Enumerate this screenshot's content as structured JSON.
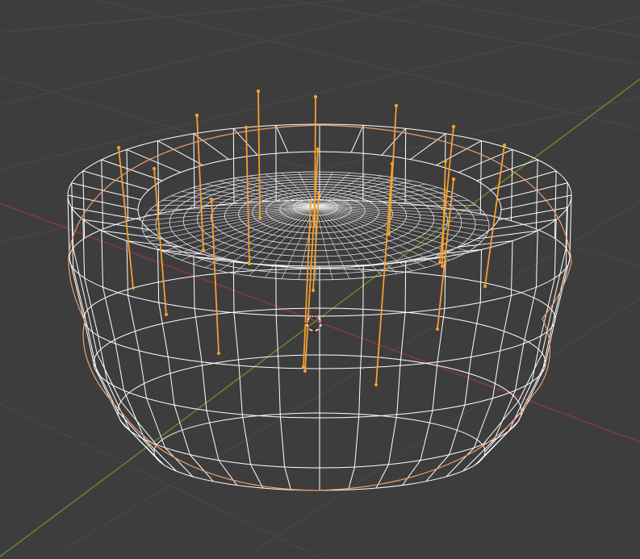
{
  "viewport": {
    "background": "#3d3d3d",
    "grid_color": "#4a4a4a",
    "x_axis_color": "#8b3a44",
    "y_axis_color": "#6b8a2e"
  },
  "mesh": {
    "wire_color": "#ffffff",
    "selection_outline_color": "#f0a070",
    "inner_wire_color": "#e8e8e8"
  },
  "hair_strands": {
    "color": "#f5a030",
    "count": 16
  },
  "cursor_3d": {
    "ring_color_a": "#e05050",
    "ring_color_b": "#ffffff"
  }
}
